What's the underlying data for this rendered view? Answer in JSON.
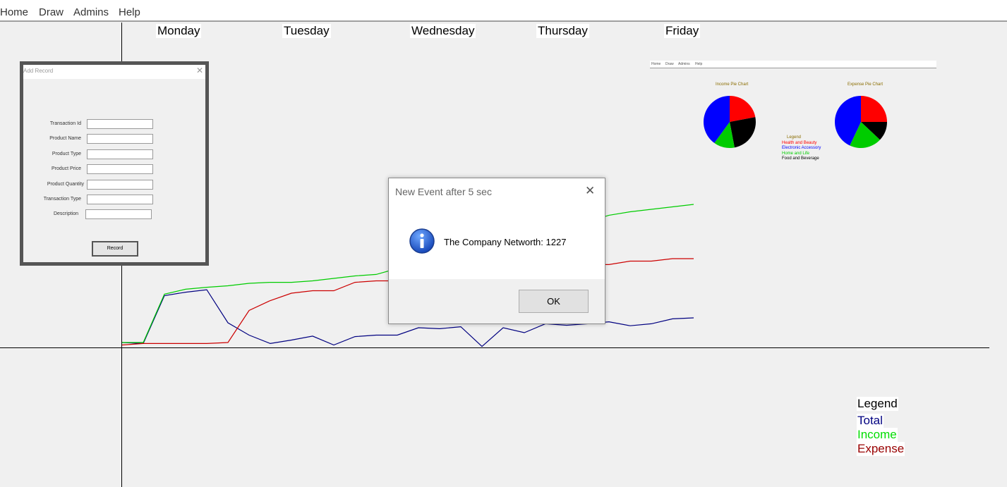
{
  "menu": [
    "Home",
    "Draw",
    "Admins",
    "Help"
  ],
  "days": [
    "Monday",
    "Tuesday",
    "Wednesday",
    "Thursday",
    "Friday"
  ],
  "add_record": {
    "title": "Add Record",
    "close": "✕",
    "fields": [
      "Transaction Id",
      "Product Name",
      "Product Type",
      "Product Price",
      "Product Quantity",
      "Transaction Type",
      "Description"
    ],
    "button": "Record"
  },
  "mini": {
    "menu": [
      "Home",
      "Draw",
      "Admins",
      "Help"
    ],
    "income_title": "Income Pie Chart",
    "expense_title": "Expense Pie Chart",
    "legend_title": "Legend",
    "legend_items": [
      {
        "label": "Health and Beauty",
        "color": "#ff0000"
      },
      {
        "label": "Electronic Accessory",
        "color": "#0000ff"
      },
      {
        "label": "Home and Life",
        "color": "#00cc00"
      },
      {
        "label": "Food and Beverage",
        "color": "#000000"
      }
    ]
  },
  "dialog": {
    "title": "New Event after 5 sec",
    "close": "✕",
    "message": "The Company Networth: 1227",
    "ok": "OK",
    "icon": "info-icon"
  },
  "legend": {
    "title": "Legend",
    "items": [
      {
        "label": "Total",
        "color": "#000080"
      },
      {
        "label": "Income",
        "color": "#00dd00"
      },
      {
        "label": "Expense",
        "color": "#990000"
      }
    ]
  },
  "chart_data": {
    "type": "line",
    "categories": [
      "Monday",
      "Tuesday",
      "Wednesday",
      "Thursday",
      "Friday"
    ],
    "series": [
      {
        "name": "Total",
        "color": "#000080",
        "values": [
          10,
          8,
          105,
          112,
          117,
          50,
          25,
          8,
          15,
          23,
          5,
          22,
          25,
          25,
          40,
          38,
          42,
          2,
          40,
          30,
          48,
          45,
          48,
          52,
          44,
          48,
          58,
          60
        ]
      },
      {
        "name": "Income",
        "color": "#00cc00",
        "values": [
          10,
          10,
          108,
          118,
          122,
          125,
          130,
          132,
          132,
          135,
          140,
          145,
          148,
          160,
          180,
          188,
          195,
          200,
          205,
          210,
          230,
          245,
          255,
          268,
          275,
          280,
          285,
          290
        ]
      },
      {
        "name": "Expense",
        "color": "#cc0000",
        "values": [
          5,
          8,
          8,
          8,
          8,
          10,
          75,
          95,
          110,
          115,
          115,
          132,
          135,
          135,
          140,
          145,
          150,
          152,
          152,
          155,
          160,
          163,
          168,
          168,
          175,
          175,
          180,
          180
        ]
      }
    ],
    "income_pie": [
      {
        "label": "Health and Beauty",
        "value": 22
      },
      {
        "label": "Food and Beverage",
        "value": 25
      },
      {
        "label": "Home and Life",
        "value": 13
      },
      {
        "label": "Electronic Accessory",
        "value": 40
      }
    ],
    "expense_pie": [
      {
        "label": "Health and Beauty",
        "value": 25
      },
      {
        "label": "Food and Beverage",
        "value": 12
      },
      {
        "label": "Home and Life",
        "value": 20
      },
      {
        "label": "Electronic Accessory",
        "value": 43
      }
    ]
  }
}
